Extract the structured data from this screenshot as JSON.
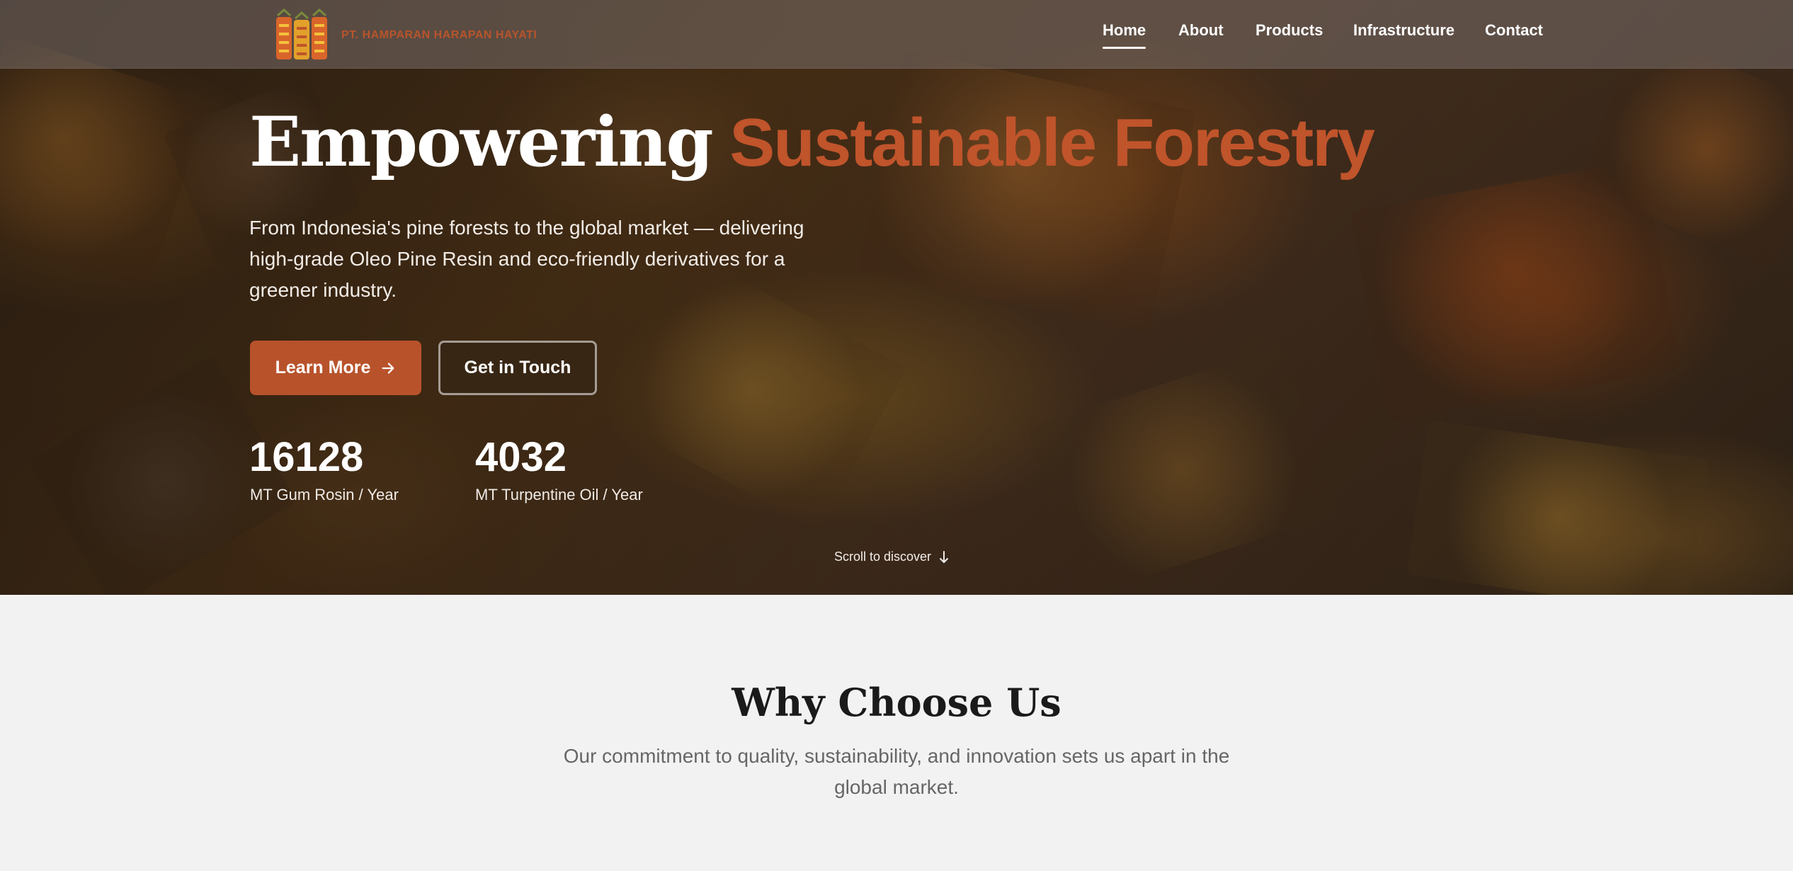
{
  "brand": {
    "name": "PT. HAMPARAN HARAPAN HAYATI",
    "logo_icon": "resin-barrels-logo"
  },
  "nav": {
    "items": [
      {
        "label": "Home",
        "active": true
      },
      {
        "label": "About"
      },
      {
        "label": "Products"
      },
      {
        "label": "Infrastructure"
      },
      {
        "label": "Contact"
      }
    ]
  },
  "hero": {
    "headline_white": "Empowering",
    "headline_accent": "Sustainable Forestry",
    "subtitle": "From Indonesia's pine forests to the global market — delivering high-grade Oleo Pine Resin and eco-friendly derivatives for a greener industry.",
    "primary_button": "Learn More",
    "secondary_button": "Get in Touch",
    "stats": [
      {
        "value": "16128",
        "label": "MT Gum Rosin / Year"
      },
      {
        "value": "4032",
        "label": "MT Turpentine Oil / Year"
      }
    ],
    "scroll_hint": "Scroll to discover"
  },
  "why": {
    "title": "Why Choose Us",
    "subtitle": "Our commitment to quality, sustainability, and innovation sets us apart in the global market."
  },
  "colors": {
    "accent": "#c0542b",
    "button": "#b8522b",
    "section_bg": "#f2f2f2"
  }
}
